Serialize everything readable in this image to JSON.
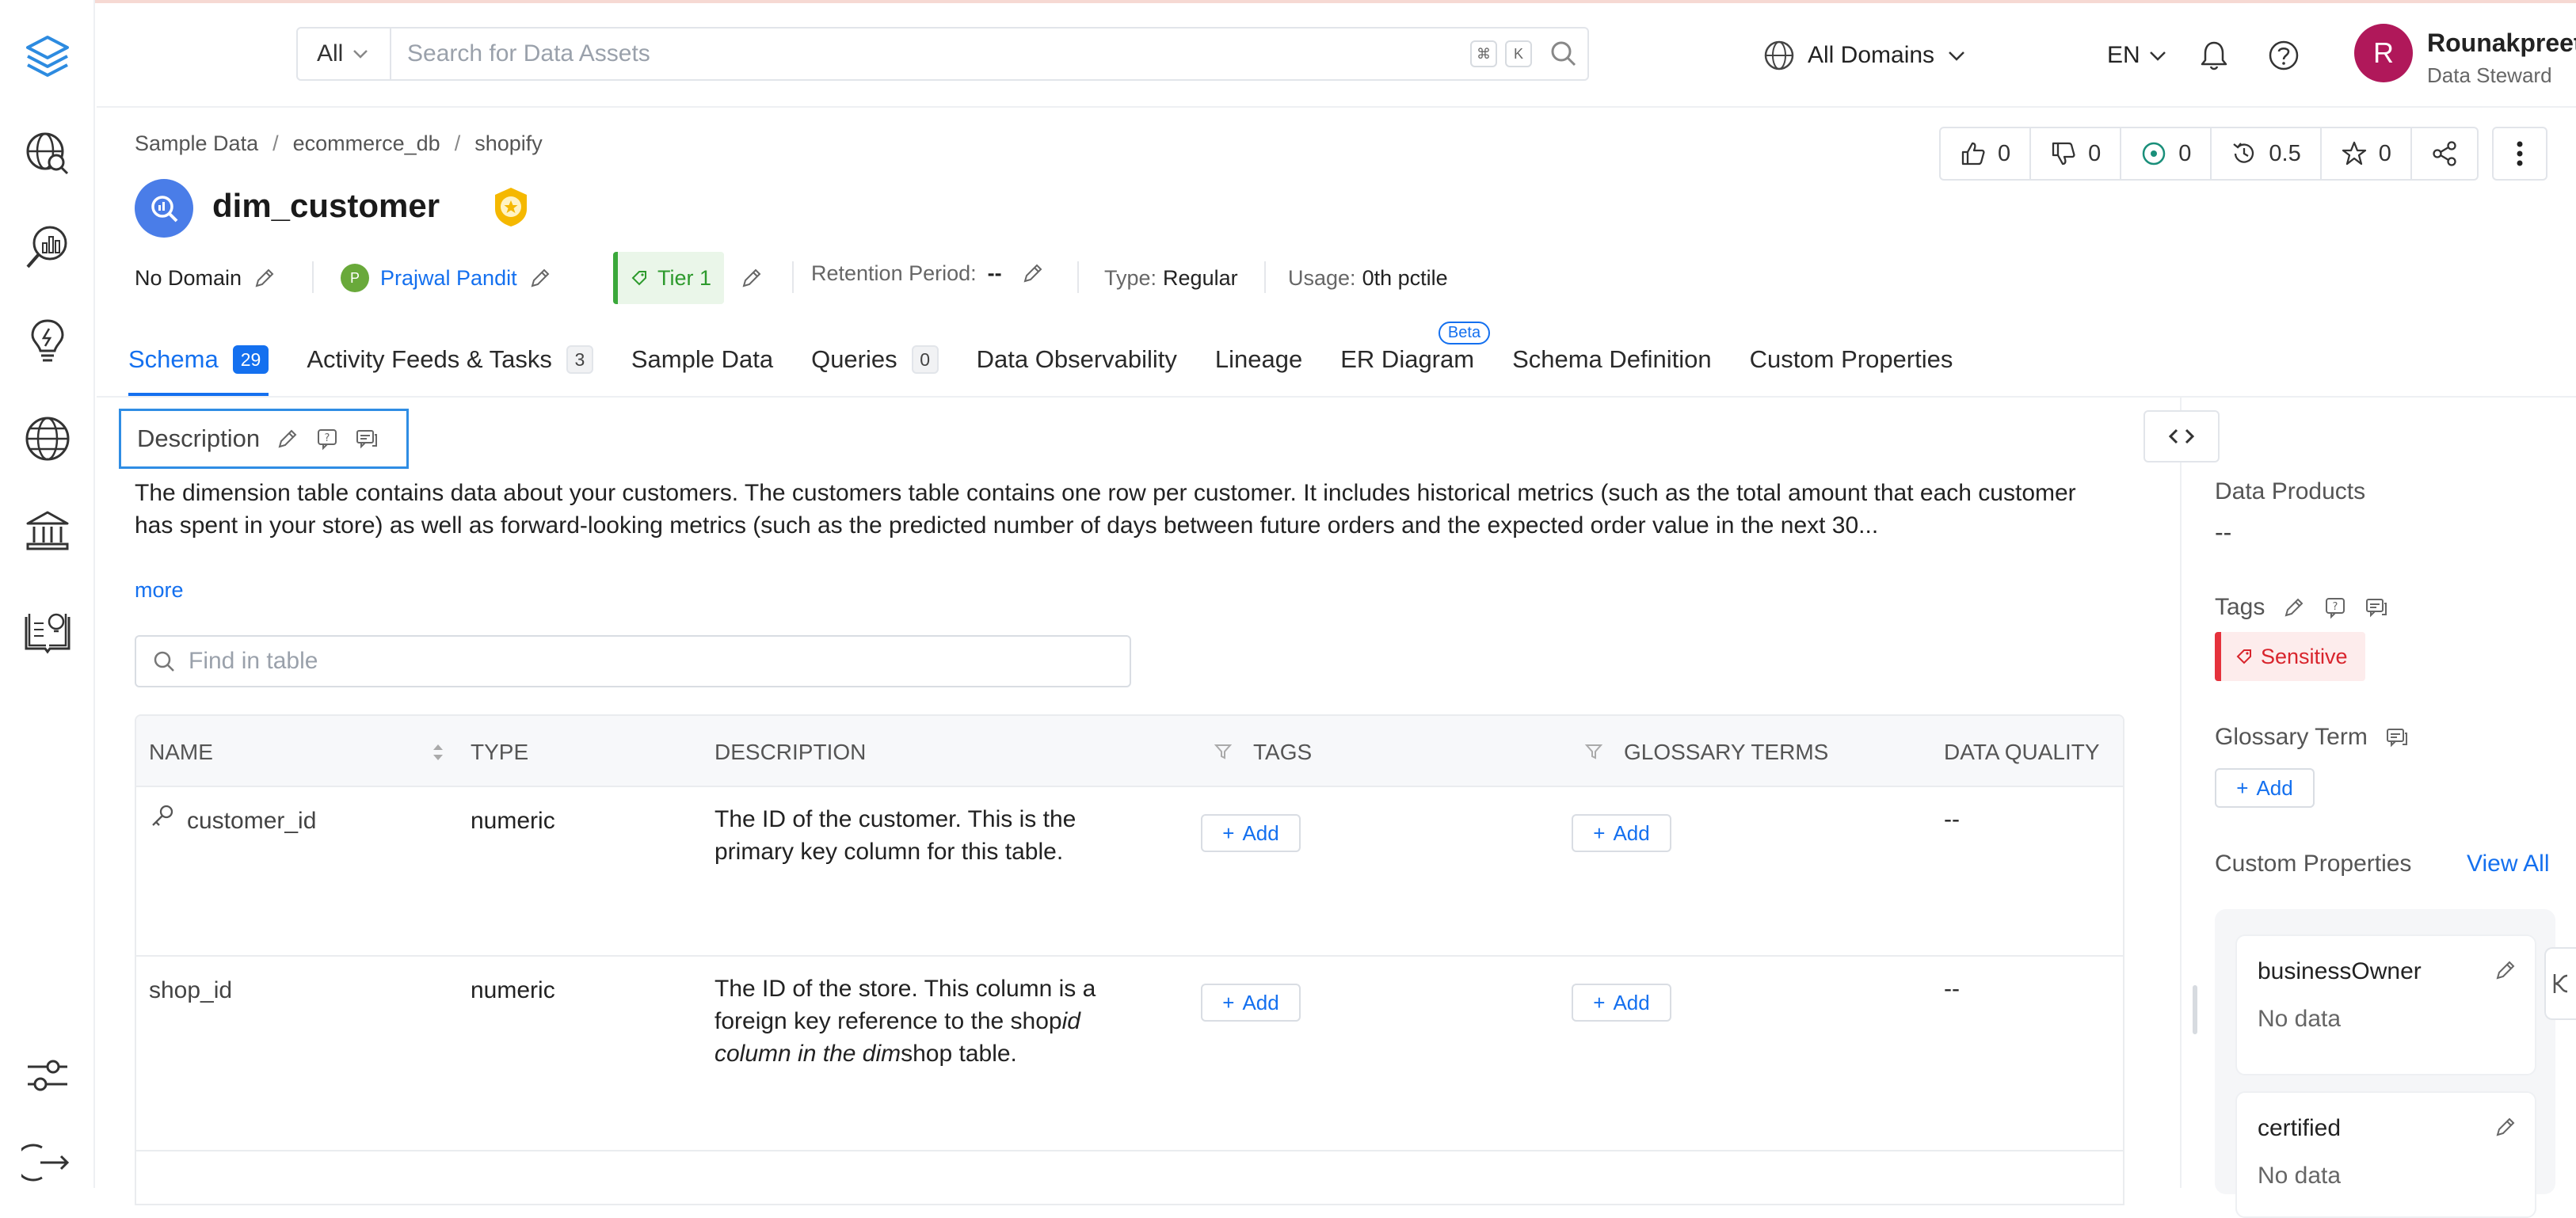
{
  "search": {
    "scope": "All",
    "placeholder": "Search for Data Assets",
    "shortcut_cmd": "⌘",
    "shortcut_key": "K"
  },
  "header": {
    "domains_label": "All Domains",
    "language": "EN"
  },
  "user": {
    "initial": "R",
    "name": "Rounakpreet.d",
    "role": "Data Steward"
  },
  "breadcrumb": [
    "Sample Data",
    "ecommerce_db",
    "shopify"
  ],
  "entity": {
    "title": "dim_customer"
  },
  "stats": {
    "upvotes": "0",
    "downvotes": "0",
    "tasks": "0",
    "version": "0.5",
    "stars": "0"
  },
  "meta": {
    "domain": "No Domain",
    "owner_initial": "P",
    "owner_name": "Prajwal Pandit",
    "tier": "Tier 1",
    "retention_label": "Retention Period:",
    "retention_value": "--",
    "type_label": "Type:",
    "type_value": "Regular",
    "usage_label": "Usage:",
    "usage_value": "0th pctile"
  },
  "tabs": [
    {
      "label": "Schema",
      "count": "29"
    },
    {
      "label": "Activity Feeds & Tasks",
      "count": "3"
    },
    {
      "label": "Sample Data"
    },
    {
      "label": "Queries",
      "count": "0"
    },
    {
      "label": "Data Observability"
    },
    {
      "label": "Lineage"
    },
    {
      "label": "ER Diagram",
      "badge": "Beta"
    },
    {
      "label": "Schema Definition"
    },
    {
      "label": "Custom Properties"
    }
  ],
  "description": {
    "heading": "Description",
    "text": "The dimension table contains data about your customers. The customers table contains one row per customer. It includes historical metrics (such as the total amount that each customer has spent in your store) as well as forward-looking metrics (such as the predicted number of days between future orders and the expected order value in the next 30...",
    "more": "more"
  },
  "find": {
    "placeholder": "Find in table"
  },
  "table": {
    "headers": {
      "name": "NAME",
      "type": "TYPE",
      "description": "DESCRIPTION",
      "tags": "TAGS",
      "glossary": "GLOSSARY TERMS",
      "quality": "DATA QUALITY"
    },
    "add_label": "Add",
    "rows": [
      {
        "name": "customer_id",
        "type": "numeric",
        "description": "The ID of the customer. This is the primary key column for this table.",
        "quality": "--"
      },
      {
        "name": "shop_id",
        "type": "numeric",
        "desc_a": "The ID of the store. This column is a foreign key reference to the shop",
        "desc_b": "id column in the dim",
        "desc_c": "shop table.",
        "quality": "--"
      }
    ]
  },
  "panel": {
    "data_products_label": "Data Products",
    "data_products_value": "--",
    "tags_label": "Tags",
    "tag": "Sensitive",
    "glossary_label": "Glossary Term",
    "glossary_add": "Add",
    "custom_props_label": "Custom Properties",
    "view_all": "View All",
    "properties": [
      {
        "name": "businessOwner",
        "value": "No data"
      },
      {
        "name": "certified",
        "value": "No data"
      }
    ]
  },
  "colors": {
    "accent": "#1470ef",
    "tier_green": "#3aa83a",
    "sensitive_red": "#e5323c",
    "avatar": "#b0185a"
  }
}
